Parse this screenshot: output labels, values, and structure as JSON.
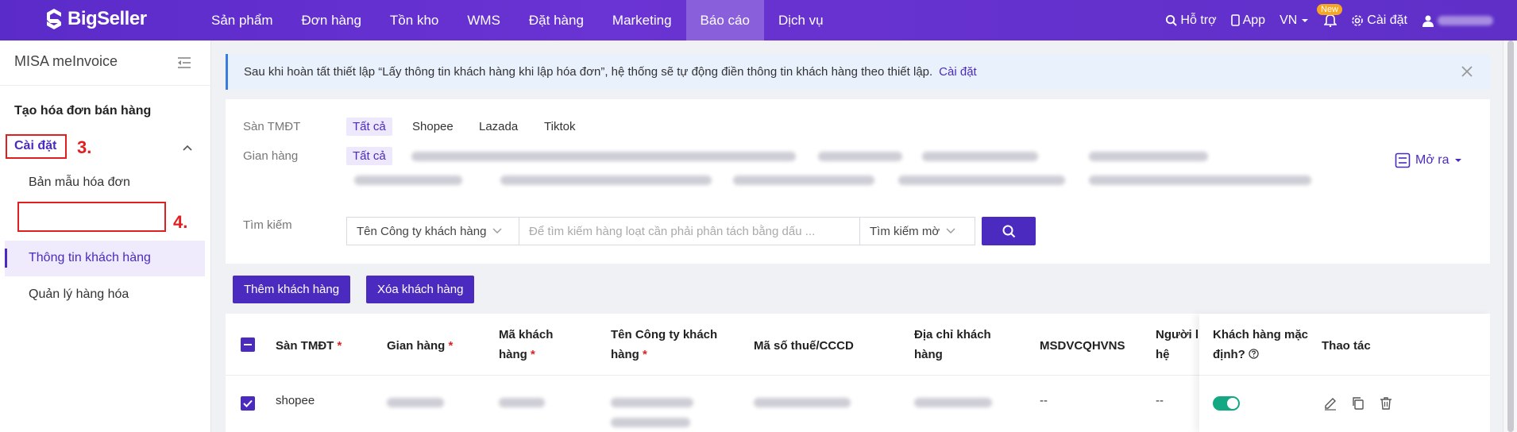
{
  "brand": {
    "name": "BigSeller"
  },
  "nav": [
    "Sản phẩm",
    "Đơn hàng",
    "Tồn kho",
    "WMS",
    "Đặt hàng",
    "Marketing",
    "Báo cáo",
    "Dịch vụ"
  ],
  "topright": {
    "support": "Hỗ trợ",
    "app": "App",
    "lang": "VN",
    "new_badge": "New",
    "settings": "Cài đặt"
  },
  "sidebar": {
    "title": "MISA meInvoice",
    "section": "Tạo hóa đơn bán hàng",
    "group": "Cài đặt",
    "items": [
      "Bản mẫu hóa đơn",
      "Thông tin khách hàng",
      "Quản lý hàng hóa"
    ],
    "step3": "3.",
    "step4": "4."
  },
  "notice": {
    "text": "Sau khi hoàn tất thiết lập “Lấy thông tin khách hàng khi lập hóa đơn”, hệ thống sẽ tự động điền thông tin khách hàng theo thiết lập.",
    "link": "Cài đặt"
  },
  "filter": {
    "platform_label": "Sàn TMĐT",
    "platforms": [
      "Tất cả",
      "Shopee",
      "Lazada",
      "Tiktok"
    ],
    "shop_label": "Gian hàng",
    "shop_all": "Tất cả",
    "expand": "Mở ra",
    "search_label": "Tìm kiếm",
    "search_field": "Tên Công ty khách hàng",
    "search_placeholder": "Để tìm kiếm hàng loạt cần phải phân tách bằng dấu ...",
    "match_mode": "Tìm kiếm mờ"
  },
  "actions": {
    "add": "Thêm khách hàng",
    "delete": "Xóa khách hàng"
  },
  "table": {
    "headers": {
      "platform": "Sàn TMĐT",
      "shop": "Gian hàng",
      "code_1": "Mã khách",
      "code_2": "hàng",
      "company_1": "Tên Công ty khách",
      "company_2": "hàng",
      "tax": "Mã số thuế/CCCD",
      "address_1": "Địa chỉ khách",
      "address_2": "hàng",
      "msdv": "MSDVCQHVNS",
      "contact_1": "Người li",
      "contact_2": "hệ",
      "default_1": "Khách hàng mặc",
      "default_2": "định?",
      "ops": "Thao tác"
    },
    "required_mark": "*",
    "rows": [
      {
        "platform": "shopee",
        "msdv": "--",
        "contact": "--",
        "is_default": true
      }
    ]
  },
  "colors": {
    "primary": "#4b2bbf",
    "annotation": "#e02020",
    "toggle_on": "#13a881"
  }
}
